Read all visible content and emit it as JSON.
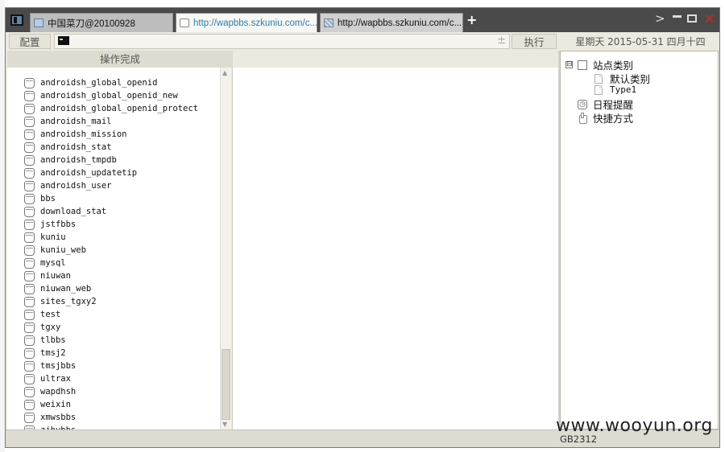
{
  "tabs": [
    {
      "label": "中国菜刀@20100928",
      "active": false
    },
    {
      "label": "http://wapbbs.szkuniu.com/c...",
      "active": true
    },
    {
      "label": "http://wapbbs.szkuniu.com/c...",
      "active": false
    }
  ],
  "window_controls": {
    "new_tab": "+",
    "next": ">",
    "close": "✕"
  },
  "toolbar": {
    "config_label": "配置",
    "command_value": "",
    "command_plus": "±",
    "execute_label": "执行",
    "datetime": "星期天  2015-05-31  四月十四"
  },
  "status_header": "操作完成",
  "databases": [
    "androidsh_global_openid",
    "androidsh_global_openid_new",
    "androidsh_global_openid_protect",
    "androidsh_mail",
    "androidsh_mission",
    "androidsh_stat",
    "androidsh_tmpdb",
    "androidsh_updatetip",
    "androidsh_user",
    "bbs",
    "download_stat",
    "jstfbbs",
    "kuniu",
    "kuniu_web",
    "mysql",
    "niuwan",
    "niuwan_web",
    "sites_tgxy2",
    "test",
    "tgxy",
    "tlbbs",
    "tmsj2",
    "tmsjbbs",
    "ultrax",
    "wapdhsh",
    "weixin",
    "xmwsbbs",
    "zjhybbs"
  ],
  "tree": {
    "root_expander": "⊟",
    "root_label": "站点类别",
    "children": [
      "默认类别",
      "Type1"
    ],
    "schedule_label": "日程提醒",
    "shortcut_label": "快捷方式"
  },
  "status_bar": {
    "encoding": "GB2312"
  },
  "watermark": "www.wooyun.org"
}
